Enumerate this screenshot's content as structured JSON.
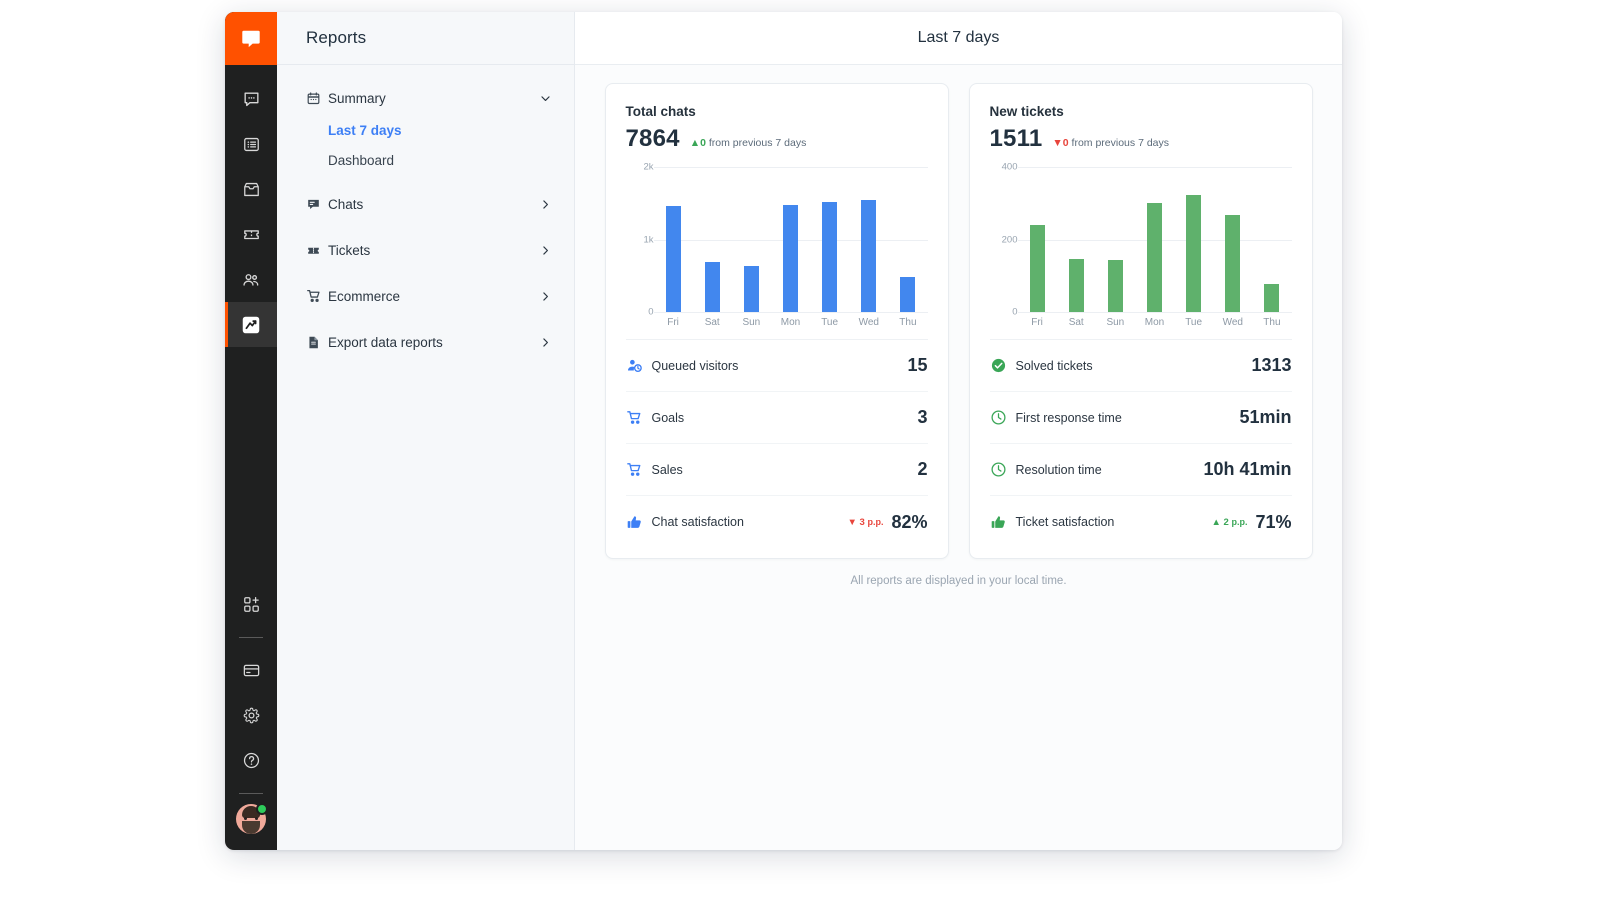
{
  "colors": {
    "brand_orange": "#ff5100",
    "accent_blue": "#3d7ff5",
    "bar_blue": "#4287ee",
    "bar_green": "#5fb16c",
    "up_green": "#3aa657",
    "down_red": "#e8453c",
    "rail_dark": "#1f2020"
  },
  "rail": {
    "logo_icon": "livechat-logo-icon",
    "items": [
      {
        "icon": "chat-bubble-icon",
        "name": "rail-item-chats",
        "active": false
      },
      {
        "icon": "list-icon",
        "name": "rail-item-archives",
        "active": false
      },
      {
        "icon": "inbox-icon",
        "name": "rail-item-inbox",
        "active": false
      },
      {
        "icon": "ticket-icon",
        "name": "rail-item-tickets",
        "active": false
      },
      {
        "icon": "team-icon",
        "name": "rail-item-team",
        "active": false
      },
      {
        "icon": "chart-line-icon",
        "name": "rail-item-reports",
        "active": true
      }
    ],
    "bottom_items": [
      {
        "icon": "apps-add-icon",
        "name": "rail-item-apps"
      },
      {
        "icon": "billing-card-icon",
        "name": "rail-item-billing"
      },
      {
        "icon": "gear-icon",
        "name": "rail-item-settings"
      },
      {
        "icon": "question-circle-icon",
        "name": "rail-item-help"
      }
    ],
    "avatar": {
      "name": "avatar",
      "status": "online"
    }
  },
  "navpanel": {
    "title": "Reports",
    "groups": [
      {
        "label": "Summary",
        "icon": "calendar-icon",
        "chevron": "chevron-down-icon",
        "expanded": true,
        "children": [
          {
            "label": "Last 7 days",
            "active": true
          },
          {
            "label": "Dashboard",
            "active": false
          }
        ]
      },
      {
        "label": "Chats",
        "icon": "chat-square-icon",
        "chevron": "chevron-right-icon",
        "expanded": false,
        "children": []
      },
      {
        "label": "Tickets",
        "icon": "ticket-filled-icon",
        "chevron": "chevron-right-icon",
        "expanded": false,
        "children": []
      },
      {
        "label": "Ecommerce",
        "icon": "cart-icon",
        "chevron": "chevron-right-icon",
        "expanded": false,
        "children": []
      },
      {
        "label": "Export data reports",
        "icon": "file-export-icon",
        "chevron": "chevron-right-icon",
        "expanded": false,
        "children": []
      }
    ]
  },
  "header": {
    "title": "Last 7 days"
  },
  "cards": [
    {
      "title": "Total chats",
      "value": "7864",
      "delta": {
        "direction": "up",
        "arrow": "▲",
        "value": "0",
        "suffix": "from previous 7 days"
      },
      "metrics": [
        {
          "icon": "queued-visitors-icon",
          "label": "Queued visitors",
          "value": "15",
          "delta": null,
          "icon_color": "#3d7ff5"
        },
        {
          "icon": "cart-icon",
          "label": "Goals",
          "value": "3",
          "delta": null,
          "icon_color": "#3d7ff5"
        },
        {
          "icon": "cart-icon",
          "label": "Sales",
          "value": "2",
          "delta": null,
          "icon_color": "#3d7ff5"
        },
        {
          "icon": "thumbs-up-icon",
          "label": "Chat satisfaction",
          "value": "82%",
          "delta": {
            "direction": "down",
            "arrow": "▼",
            "value": "3",
            "unit": "p.p."
          },
          "icon_color": "#3d7ff5"
        }
      ]
    },
    {
      "title": "New tickets",
      "value": "1511",
      "delta": {
        "direction": "down",
        "arrow": "▼",
        "value": "0",
        "suffix": "from previous 7 days"
      },
      "metrics": [
        {
          "icon": "check-circle-icon",
          "label": "Solved tickets",
          "value": "1313",
          "delta": null,
          "icon_color": "#3aa657"
        },
        {
          "icon": "clock-icon",
          "label": "First response time",
          "value": "51min",
          "delta": null,
          "icon_color": "#3aa657"
        },
        {
          "icon": "clock-icon",
          "label": "Resolution time",
          "value": "10h 41min",
          "delta": null,
          "icon_color": "#3aa657"
        },
        {
          "icon": "thumbs-up-icon",
          "label": "Ticket satisfaction",
          "value": "71%",
          "delta": {
            "direction": "up",
            "arrow": "▲",
            "value": "2",
            "unit": "p.p."
          },
          "icon_color": "#3aa657"
        }
      ]
    }
  ],
  "chart_data": [
    {
      "type": "bar",
      "title": "Total chats",
      "categories": [
        "Fri",
        "Sat",
        "Sun",
        "Mon",
        "Tue",
        "Wed",
        "Thu"
      ],
      "values": [
        1464,
        686,
        632,
        1477,
        1523,
        1541,
        486
      ],
      "ytick_labels": [
        "0",
        "1k",
        "2k"
      ],
      "ytick_values": [
        0,
        1000,
        2000
      ],
      "ylim": [
        0,
        2000
      ],
      "xlabel": "",
      "ylabel": "",
      "grid": true,
      "color": "#4287ee",
      "total": 7864
    },
    {
      "type": "bar",
      "title": "New tickets",
      "categories": [
        "Fri",
        "Sat",
        "Sun",
        "Mon",
        "Tue",
        "Wed",
        "Thu"
      ],
      "values": [
        240,
        145,
        143,
        300,
        323,
        267,
        76
      ],
      "ytick_labels": [
        "0",
        "200",
        "400"
      ],
      "ytick_values": [
        0,
        200,
        400
      ],
      "ylim": [
        0,
        400
      ],
      "xlabel": "",
      "ylabel": "",
      "grid": true,
      "color": "#5fb16c",
      "total": 1511
    }
  ],
  "footnote": "All reports are displayed in your local time."
}
